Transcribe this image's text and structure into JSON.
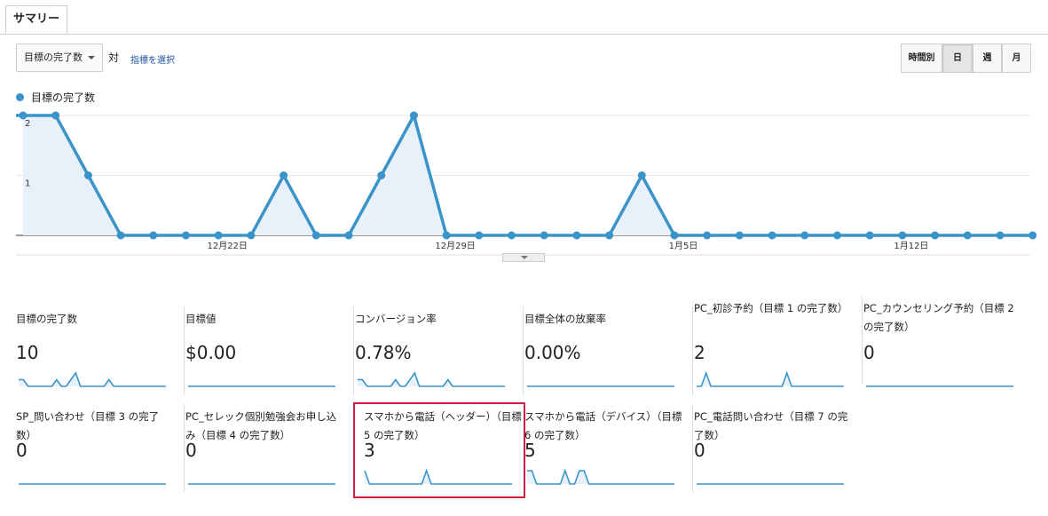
{
  "tabs": [
    {
      "label": "サマリー"
    }
  ],
  "controls": {
    "metric_select": "目標の完了数",
    "vs_label": "対",
    "pick_metric": "指標を選択"
  },
  "period_buttons": [
    {
      "label": "時間別",
      "active": false
    },
    {
      "label": "日",
      "active": true
    },
    {
      "label": "週",
      "active": false
    },
    {
      "label": "月",
      "active": false
    }
  ],
  "legend": {
    "series_name": "目標の完了数",
    "color": "#3a93c9"
  },
  "chart_data": {
    "type": "area",
    "series": [
      {
        "name": "目標の完了数",
        "values": [
          2,
          2,
          1,
          0,
          0,
          0,
          0,
          0,
          1,
          0,
          0,
          1,
          2,
          0,
          0,
          0,
          0,
          0,
          0,
          1,
          0,
          0,
          0,
          0,
          0,
          0,
          0,
          0,
          0,
          0,
          0,
          0
        ]
      }
    ],
    "x_tick_labels": [
      "12月22日",
      "12月29日",
      "1月5日",
      "1月12日"
    ],
    "x_tick_index": [
      6,
      13,
      20,
      27
    ],
    "y_tick_labels": [
      "2",
      "1"
    ],
    "ylim": [
      0,
      2
    ],
    "grid": true,
    "legend": "top-left",
    "color": "#3a93c9",
    "fill": "#e8f1fa"
  },
  "scorecards": [
    {
      "label": "目標の完了数",
      "value": "10",
      "spark": [
        1,
        1,
        0,
        0,
        0,
        0,
        0,
        0,
        1,
        0,
        0,
        1,
        2,
        0,
        0,
        0,
        0,
        0,
        0,
        1,
        0,
        0,
        0,
        0,
        0,
        0,
        0,
        0,
        0,
        0,
        0,
        0
      ]
    },
    {
      "label": "目標値",
      "value": "$0.00",
      "spark": []
    },
    {
      "label": "コンバージョン率",
      "value": "0.78%",
      "spark": [
        1,
        1,
        0,
        0,
        0,
        0,
        0,
        0,
        1,
        0,
        0,
        1,
        2,
        0,
        0,
        0,
        0,
        0,
        0,
        1,
        0,
        0,
        0,
        0,
        0,
        0,
        0,
        0,
        0,
        0,
        0,
        0
      ]
    },
    {
      "label": "目標全体の放棄率",
      "value": "0.00%",
      "spark": []
    },
    {
      "label": "PC_初診予約（目標 1 の完了数）",
      "value": "2",
      "spark": [
        0,
        0,
        1,
        0,
        0,
        0,
        0,
        0,
        0,
        0,
        0,
        0,
        0,
        0,
        0,
        0,
        0,
        0,
        0,
        1,
        0,
        0,
        0,
        0,
        0,
        0,
        0,
        0,
        0,
        0,
        0,
        0
      ]
    },
    {
      "label": "PC_カウンセリング予約（目標 2 の完了数）",
      "value": "0",
      "spark": []
    },
    {
      "label": "SP_問い合わせ（目標 3 の完了数）",
      "value": "0",
      "spark": []
    },
    {
      "label": "PC_セレック個別勉強会お申し込み（目標 4 の完了数）",
      "value": "0",
      "spark": []
    },
    {
      "label": "スマホから電話（ヘッダー）（目標 5 の完了数）",
      "value": "3",
      "spark": [
        1,
        0,
        0,
        0,
        0,
        0,
        0,
        0,
        0,
        0,
        0,
        0,
        0,
        1,
        0,
        0,
        0,
        0,
        0,
        0,
        0,
        0,
        0,
        0,
        0,
        0,
        0,
        0,
        0,
        0,
        0,
        0
      ]
    },
    {
      "label": "スマホから電話（デバイス）（目標 6 の完了数）",
      "value": "5",
      "spark": [
        1,
        1,
        0,
        0,
        0,
        0,
        0,
        0,
        1,
        0,
        0,
        1,
        1,
        0,
        0,
        0,
        0,
        0,
        0,
        0,
        0,
        0,
        0,
        0,
        0,
        0,
        0,
        0,
        0,
        0,
        0,
        0
      ]
    },
    {
      "label": "PC_電話問い合わせ（目標 7 の完了数）",
      "value": "0",
      "spark": []
    }
  ]
}
